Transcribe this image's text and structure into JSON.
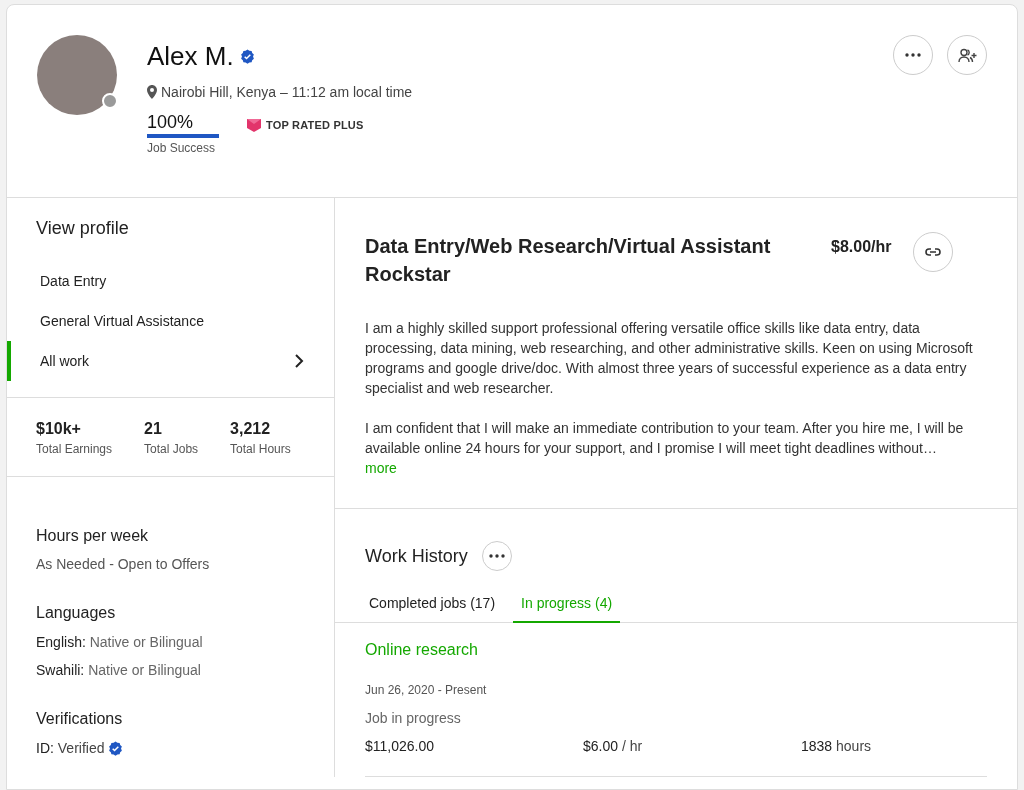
{
  "profile": {
    "name": "Alex M.",
    "verified": true,
    "online": false,
    "location": "Nairobi Hill, Kenya – 11:12 am local time",
    "job_success": {
      "value": "100%",
      "label": "Job Success",
      "level": 1
    },
    "badge": "TOP RATED PLUS"
  },
  "sidebar": {
    "title": "View profile",
    "items": [
      {
        "label": "Data Entry",
        "selected": false
      },
      {
        "label": "General Virtual Assistance",
        "selected": false
      },
      {
        "label": "All work",
        "selected": true
      }
    ],
    "stats": [
      {
        "value": "$10k+",
        "label": "Total Earnings"
      },
      {
        "value": "21",
        "label": "Total Jobs"
      },
      {
        "value": "3,212",
        "label": "Total Hours"
      }
    ],
    "hours_per_week": {
      "title": "Hours per week",
      "value": "As Needed - Open to Offers"
    },
    "languages": {
      "title": "Languages",
      "items": [
        {
          "name": "English:",
          "level": "Native or Bilingual"
        },
        {
          "name": "Swahili:",
          "level": "Native or Bilingual"
        }
      ]
    },
    "verifications": {
      "title": "Verifications",
      "items": [
        {
          "label": "ID:",
          "value": "Verified",
          "verified": true
        }
      ]
    }
  },
  "main": {
    "title": "Data Entry/Web Research/Virtual Assistant Rockstar",
    "rate": "$8.00/hr",
    "description": [
      "I am a highly skilled support professional offering versatile office skills like data entry, data processing, data mining, web researching, and other administrative skills. Keen on using Microsoft programs and google drive/doc. With almost three years of successful experience as a data entry specialist and web researcher.",
      "I am confident that I will make an immediate contribution to your team. After you hire me, I will be available online 24 hours for your support, and I promise I will meet tight deadlines without…"
    ],
    "more": "more",
    "work_history": {
      "title": "Work History",
      "tabs": [
        {
          "label": "Completed jobs (17)",
          "selected": false
        },
        {
          "label": "In progress (4)",
          "selected": true
        }
      ],
      "jobs": [
        {
          "title": "Online research",
          "dates": "Jun 26, 2020 - Present",
          "status": "Job in progress",
          "amount": "$11,026.00",
          "rate": "$6.00",
          "rate_unit": "/ hr",
          "hours": "1838",
          "hours_unit": "hours"
        }
      ]
    }
  }
}
